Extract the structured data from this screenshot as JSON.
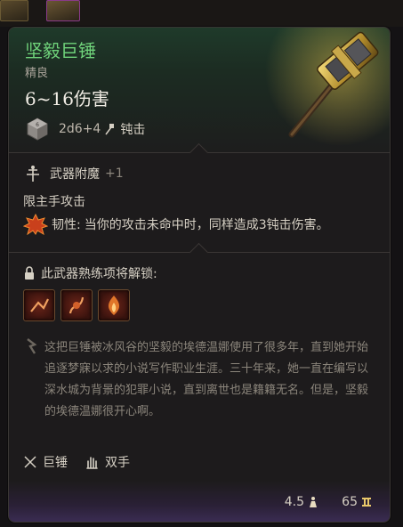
{
  "item": {
    "name": "坚毅巨锤",
    "rarity": "精良",
    "damage": "6~16伤害",
    "dice": "2d6+4",
    "damage_type": "钝击"
  },
  "enchantment": {
    "label": "武器附魔",
    "value": "+1"
  },
  "main_hand": "限主手攻击",
  "trait": {
    "name": "韧性:",
    "description": "当你的攻击未命中时，同样造成3钝击伤害。"
  },
  "proficiency": {
    "label": "此武器熟练项将解锁:"
  },
  "actions": [
    "action-1",
    "action-2",
    "action-3"
  ],
  "lore": "这把巨锤被冰风谷的坚毅的埃德温娜使用了很多年，直到她开始追逐梦寐以求的小说写作职业生涯。三十年来，她一直在编写以深水城为背景的犯罪小说，直到离世也是籍籍无名。但是，坚毅的埃德温娜很开心啊。",
  "tags": {
    "weapon_type": "巨锤",
    "handedness": "双手"
  },
  "footer": {
    "weight": "4.5",
    "price": "65"
  },
  "colors": {
    "name_green": "#6fd27a",
    "lore_grey": "#8b857b",
    "footer_purple": "#3a2c52"
  }
}
